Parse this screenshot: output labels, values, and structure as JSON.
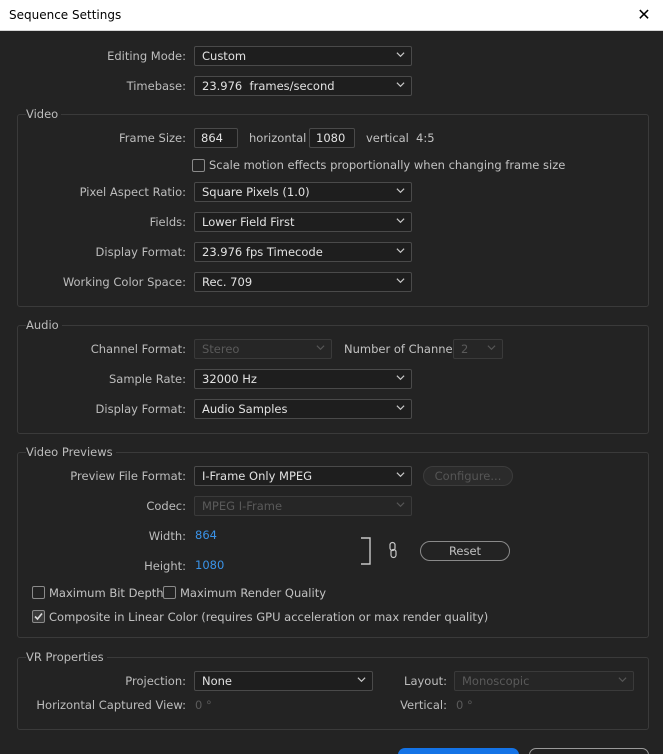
{
  "window": {
    "title": "Sequence Settings"
  },
  "general": {
    "editing_mode_label": "Editing Mode:",
    "editing_mode_value": "Custom",
    "timebase_label": "Timebase:",
    "timebase_value": "23.976  frames/second"
  },
  "video": {
    "section_title": "Video",
    "frame_size_label": "Frame Size:",
    "frame_width": "864",
    "horizontal_label": "horizontal",
    "frame_height": "1080",
    "vertical_label": "vertical",
    "aspect_ratio_text": "4:5",
    "scale_motion_label": "Scale motion effects proportionally when changing frame size",
    "scale_motion_checked": false,
    "pixel_aspect_label": "Pixel Aspect Ratio:",
    "pixel_aspect_value": "Square Pixels (1.0)",
    "fields_label": "Fields:",
    "fields_value": "Lower Field First",
    "display_format_label": "Display Format:",
    "display_format_value": "23.976 fps Timecode",
    "working_color_label": "Working Color Space:",
    "working_color_value": "Rec. 709"
  },
  "audio": {
    "section_title": "Audio",
    "channel_format_label": "Channel Format:",
    "channel_format_value": "Stereo",
    "num_channels_label": "Number of Channels:",
    "num_channels_value": "2",
    "sample_rate_label": "Sample Rate:",
    "sample_rate_value": "32000 Hz",
    "display_format_label": "Display Format:",
    "display_format_value": "Audio Samples"
  },
  "previews": {
    "section_title": "Video Previews",
    "preview_format_label": "Preview File Format:",
    "preview_format_value": "I-Frame Only MPEG",
    "configure_label": "Configure...",
    "codec_label": "Codec:",
    "codec_value": "MPEG I-Frame",
    "width_label": "Width:",
    "width_value": "864",
    "height_label": "Height:",
    "height_value": "1080",
    "reset_label": "Reset",
    "max_bit_depth_label": "Maximum Bit Depth",
    "max_bit_depth_checked": false,
    "max_render_quality_label": "Maximum Render Quality",
    "max_render_quality_checked": false,
    "composite_linear_label": "Composite in Linear Color (requires GPU acceleration or max render quality)",
    "composite_linear_checked": true
  },
  "vr": {
    "section_title": "VR Properties",
    "projection_label": "Projection:",
    "projection_value": "None",
    "layout_label": "Layout:",
    "layout_value": "Monoscopic",
    "horizontal_view_label": "Horizontal Captured View:",
    "horizontal_view_value": "0 °",
    "vertical_label": "Vertical:",
    "vertical_value": "0 °"
  },
  "colors": {
    "accent": "#3a93e8",
    "background": "#232323",
    "link": "#3a93e8"
  },
  "icons": {
    "close": "close-icon",
    "caret": "chevron-down-icon",
    "link": "link-chain-icon",
    "check": "checkmark-icon"
  }
}
